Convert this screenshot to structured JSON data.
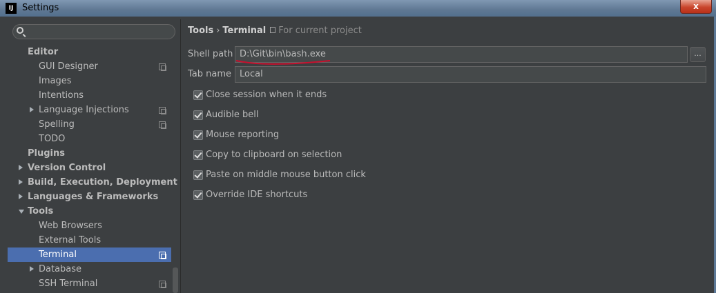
{
  "window": {
    "app_icon": "IJ",
    "title": "Settings",
    "close_label": "x"
  },
  "search": {
    "placeholder": ""
  },
  "tree": [
    {
      "label": "Editor",
      "bold": true,
      "indent": 0,
      "arrow": null,
      "copy": false,
      "selected": false
    },
    {
      "label": "GUI Designer",
      "bold": false,
      "indent": 1,
      "arrow": null,
      "copy": true,
      "selected": false
    },
    {
      "label": "Images",
      "bold": false,
      "indent": 1,
      "arrow": null,
      "copy": false,
      "selected": false
    },
    {
      "label": "Intentions",
      "bold": false,
      "indent": 1,
      "arrow": null,
      "copy": false,
      "selected": false
    },
    {
      "label": "Language Injections",
      "bold": false,
      "indent": 1,
      "arrow": "right",
      "copy": true,
      "selected": false
    },
    {
      "label": "Spelling",
      "bold": false,
      "indent": 1,
      "arrow": null,
      "copy": true,
      "selected": false
    },
    {
      "label": "TODO",
      "bold": false,
      "indent": 1,
      "arrow": null,
      "copy": false,
      "selected": false
    },
    {
      "label": "Plugins",
      "bold": true,
      "indent": 0,
      "arrow": null,
      "copy": false,
      "selected": false
    },
    {
      "label": "Version Control",
      "bold": true,
      "indent": 0,
      "arrow": "right",
      "copy": false,
      "selected": false
    },
    {
      "label": "Build, Execution, Deployment",
      "bold": true,
      "indent": 0,
      "arrow": "right",
      "copy": false,
      "selected": false
    },
    {
      "label": "Languages & Frameworks",
      "bold": true,
      "indent": 0,
      "arrow": "right",
      "copy": false,
      "selected": false
    },
    {
      "label": "Tools",
      "bold": true,
      "indent": 0,
      "arrow": "down",
      "copy": false,
      "selected": false
    },
    {
      "label": "Web Browsers",
      "bold": false,
      "indent": 1,
      "arrow": null,
      "copy": false,
      "selected": false
    },
    {
      "label": "External Tools",
      "bold": false,
      "indent": 1,
      "arrow": null,
      "copy": false,
      "selected": false
    },
    {
      "label": "Terminal",
      "bold": false,
      "indent": 1,
      "arrow": null,
      "copy": true,
      "selected": true
    },
    {
      "label": "Database",
      "bold": false,
      "indent": 1,
      "arrow": "right",
      "copy": false,
      "selected": false
    },
    {
      "label": "SSH Terminal",
      "bold": false,
      "indent": 1,
      "arrow": null,
      "copy": true,
      "selected": false
    }
  ],
  "breadcrumb": {
    "parent": "Tools",
    "separator": "›",
    "current": "Terminal",
    "scope": "For current project"
  },
  "shell_path": {
    "label": "Shell path",
    "value": "D:\\Git\\bin\\bash.exe",
    "browse_label": "..."
  },
  "tab_name": {
    "label": "Tab name",
    "value": "Local"
  },
  "options": [
    {
      "label": "Close session when it ends",
      "checked": true
    },
    {
      "label": "Audible bell",
      "checked": true
    },
    {
      "label": "Mouse reporting",
      "checked": true
    },
    {
      "label": "Copy to clipboard on selection",
      "checked": true
    },
    {
      "label": "Paste on middle mouse button click",
      "checked": true
    },
    {
      "label": "Override IDE shortcuts",
      "checked": true
    }
  ],
  "colors": {
    "background": "#3c3f41",
    "selection": "#4b6eaf",
    "annotation_underline": "#c8102e"
  }
}
